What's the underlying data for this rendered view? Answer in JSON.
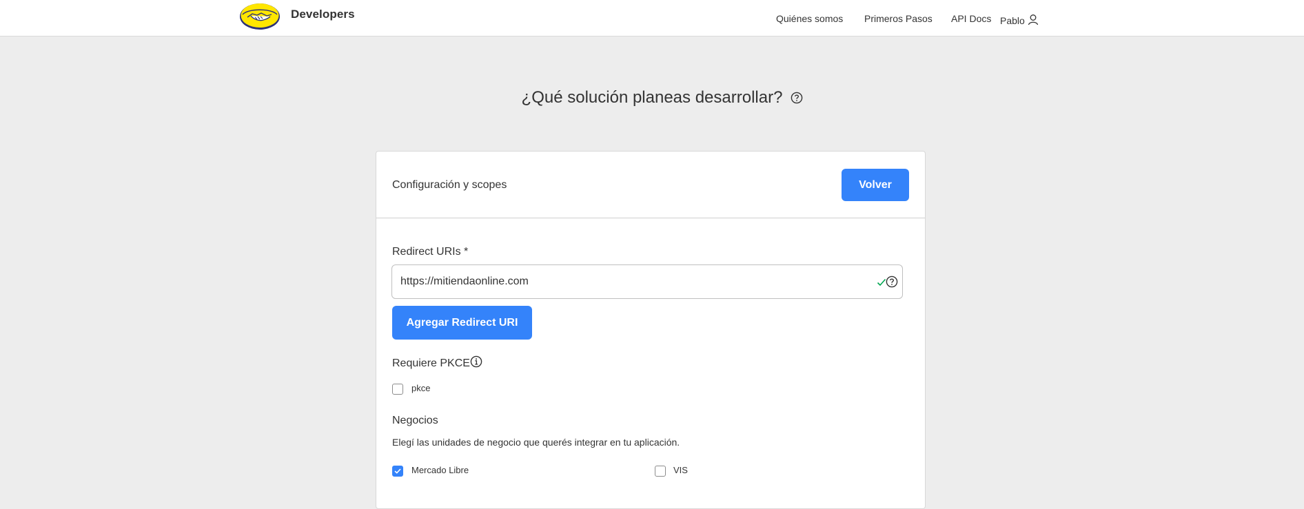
{
  "header": {
    "brand": "Developers",
    "logo_icon": "mercadolibre-handshake-logo",
    "nav": [
      {
        "label": "Quiénes somos"
      },
      {
        "label": "Primeros Pasos"
      },
      {
        "label": "API Docs"
      }
    ],
    "user": {
      "name": "Pablo",
      "icon": "user-icon"
    }
  },
  "page": {
    "title": "¿Qué solución planeas desarrollar?",
    "title_icon": "help-circle-icon"
  },
  "card": {
    "title": "Configuración y scopes",
    "back_button": "Volver",
    "redirect": {
      "label": "Redirect URIs *",
      "value": "https://mitiendaonline.com",
      "valid": true,
      "add_button": "Agregar Redirect URI"
    },
    "pkce": {
      "label": "Requiere PKCE",
      "icon": "info-icon",
      "option": {
        "label": "pkce",
        "checked": false
      }
    },
    "negocios": {
      "label": "Negocios",
      "description": "Elegí las unidades de negocio que querés integrar en tu aplicación.",
      "options": [
        {
          "label": "Mercado Libre",
          "checked": true
        },
        {
          "label": "VIS",
          "checked": false
        }
      ]
    }
  },
  "colors": {
    "accent": "#3483fa",
    "background": "#ededed",
    "valid_check": "#00a650",
    "logo_yellow": "#ffe600",
    "logo_blue": "#2d3277"
  }
}
